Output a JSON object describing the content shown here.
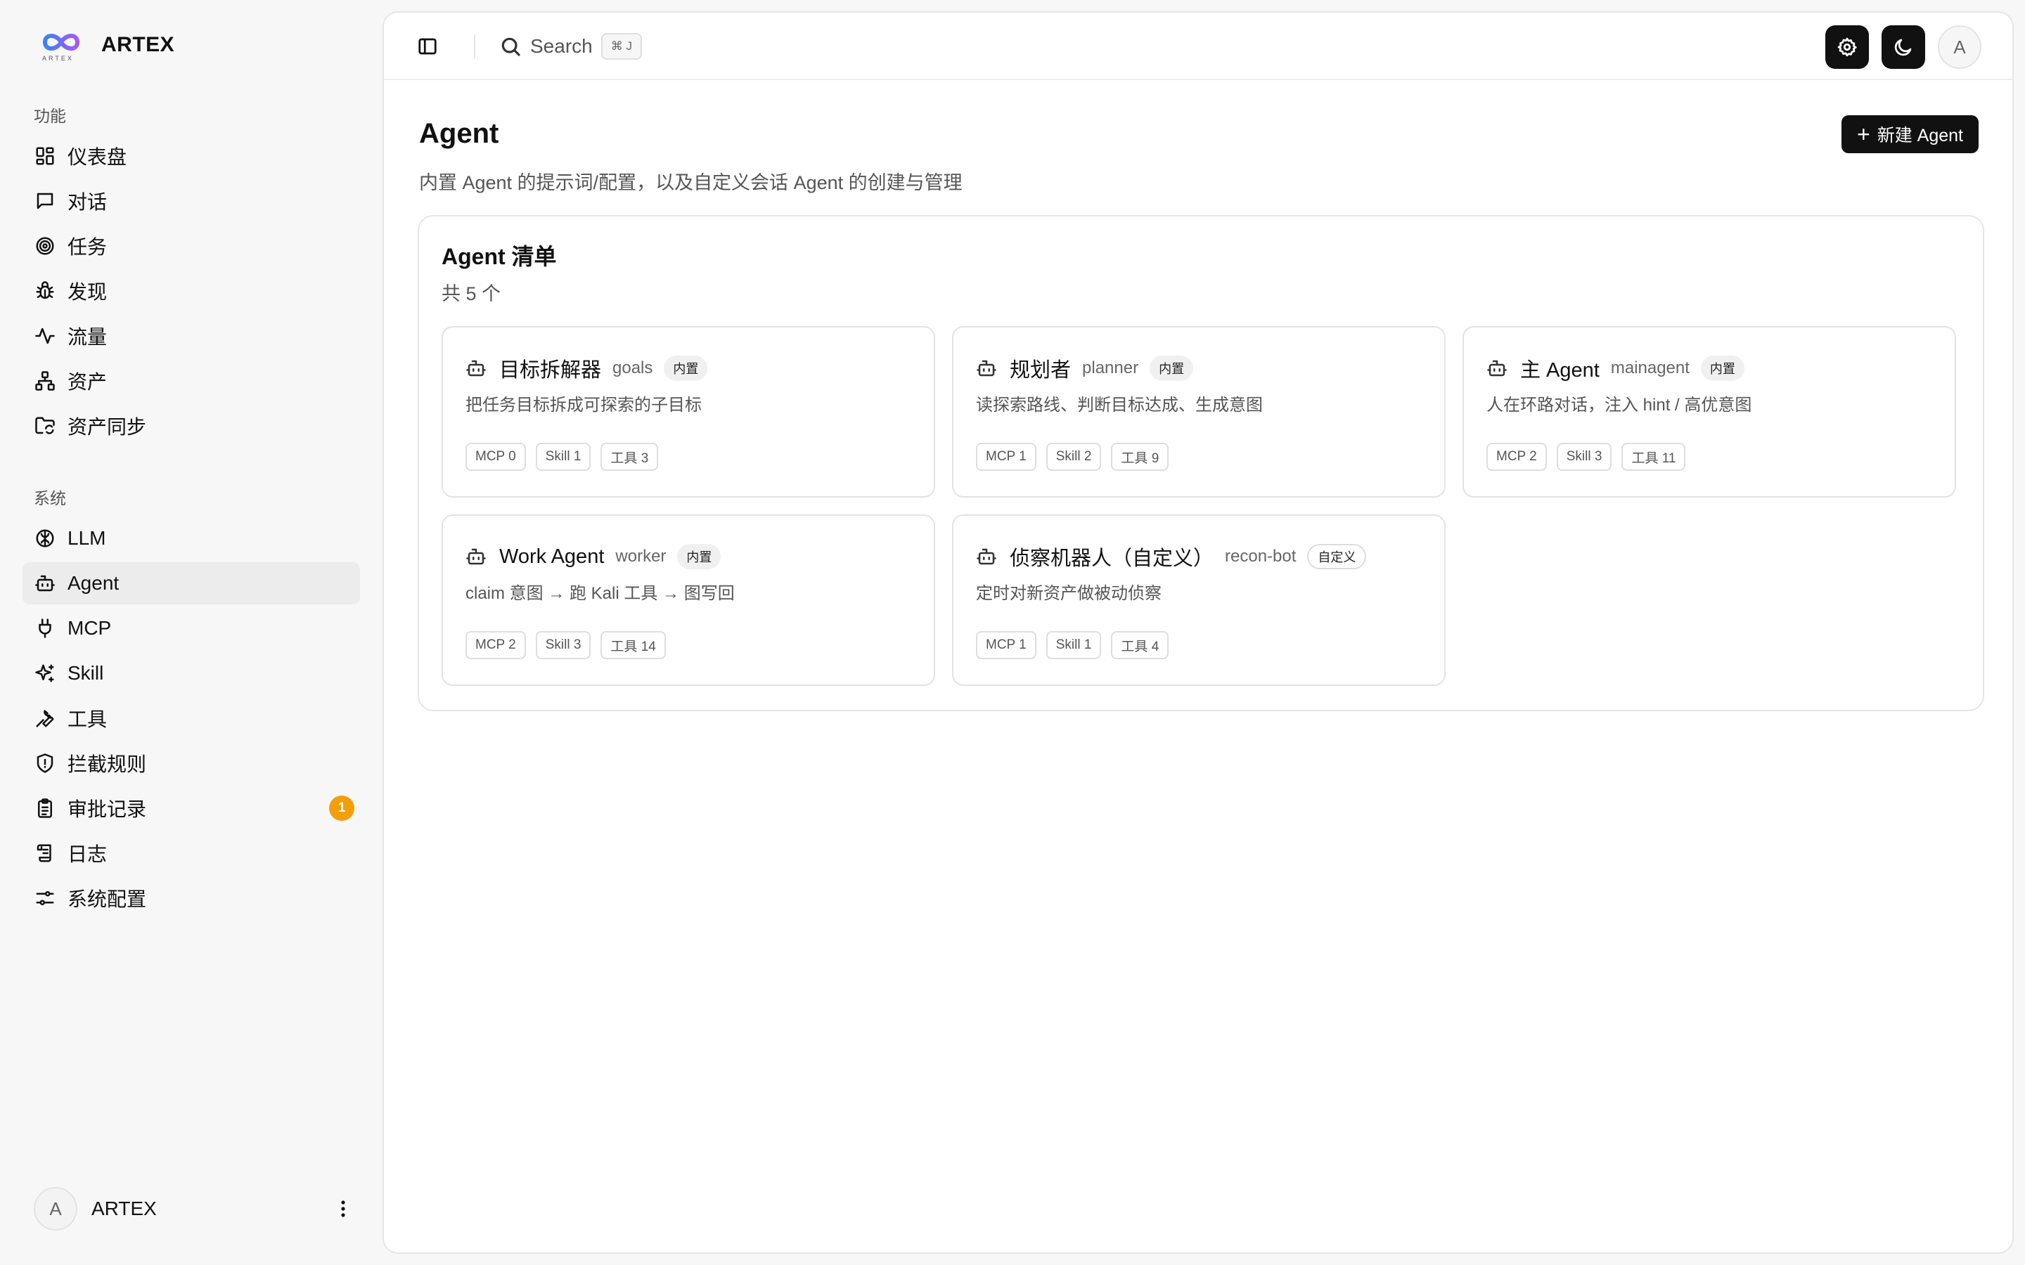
{
  "brand": {
    "name": "ARTEX",
    "logo_small": "ARTEX"
  },
  "sidebar": {
    "section_features": "功能",
    "features": [
      {
        "label": "仪表盘",
        "icon": "dashboard-icon"
      },
      {
        "label": "对话",
        "icon": "chat-icon"
      },
      {
        "label": "任务",
        "icon": "target-icon"
      },
      {
        "label": "发现",
        "icon": "bug-icon"
      },
      {
        "label": "流量",
        "icon": "activity-icon"
      },
      {
        "label": "资产",
        "icon": "network-icon"
      },
      {
        "label": "资产同步",
        "icon": "folder-sync-icon"
      }
    ],
    "section_system": "系统",
    "system": [
      {
        "label": "LLM",
        "icon": "brain-icon"
      },
      {
        "label": "Agent",
        "icon": "bot-icon",
        "active": true
      },
      {
        "label": "MCP",
        "icon": "plug-icon"
      },
      {
        "label": "Skill",
        "icon": "sparkles-icon"
      },
      {
        "label": "工具",
        "icon": "wrench-icon"
      },
      {
        "label": "拦截规则",
        "icon": "shield-alert-icon"
      },
      {
        "label": "审批记录",
        "icon": "clipboard-icon",
        "badge": "1"
      },
      {
        "label": "日志",
        "icon": "scroll-icon"
      },
      {
        "label": "系统配置",
        "icon": "sliders-icon"
      }
    ],
    "user": {
      "avatar": "A",
      "name": "ARTEX"
    }
  },
  "topbar": {
    "search_placeholder": "Search",
    "search_shortcut": "⌘ J",
    "avatar": "A"
  },
  "page": {
    "title": "Agent",
    "subtitle": "内置 Agent 的提示词/配置，以及自定义会话 Agent 的创建与管理",
    "new_button": "新建 Agent",
    "new_button_plus": "+"
  },
  "list": {
    "title": "Agent 清单",
    "count": "共 5 个",
    "agents": [
      {
        "name": "目标拆解器",
        "id": "goals",
        "tag": "内置",
        "desc": "把任务目标拆成可探索的子目标",
        "mcp": "MCP 0",
        "skill": "Skill 1",
        "tools": "工具 3"
      },
      {
        "name": "规划者",
        "id": "planner",
        "tag": "内置",
        "desc": "读探索路线、判断目标达成、生成意图",
        "mcp": "MCP 1",
        "skill": "Skill 2",
        "tools": "工具 9"
      },
      {
        "name": "主 Agent",
        "id": "mainagent",
        "tag": "内置",
        "desc": "人在环路对话，注入 hint / 高优意图",
        "mcp": "MCP 2",
        "skill": "Skill 3",
        "tools": "工具 11"
      },
      {
        "name": "Work Agent",
        "id": "worker",
        "tag": "内置",
        "desc": "claim 意图 → 跑 Kali 工具 → 图写回",
        "mcp": "MCP 2",
        "skill": "Skill 3",
        "tools": "工具 14"
      },
      {
        "name": "侦察机器人（自定义）",
        "id": "recon-bot",
        "tag": "自定义",
        "desc": "定时对新资产做被动侦察",
        "mcp": "MCP 1",
        "skill": "Skill 1",
        "tools": "工具 4"
      }
    ]
  },
  "colors": {
    "badge": "#f59e0b",
    "primary": "#111111",
    "active_bg": "#ececec"
  }
}
